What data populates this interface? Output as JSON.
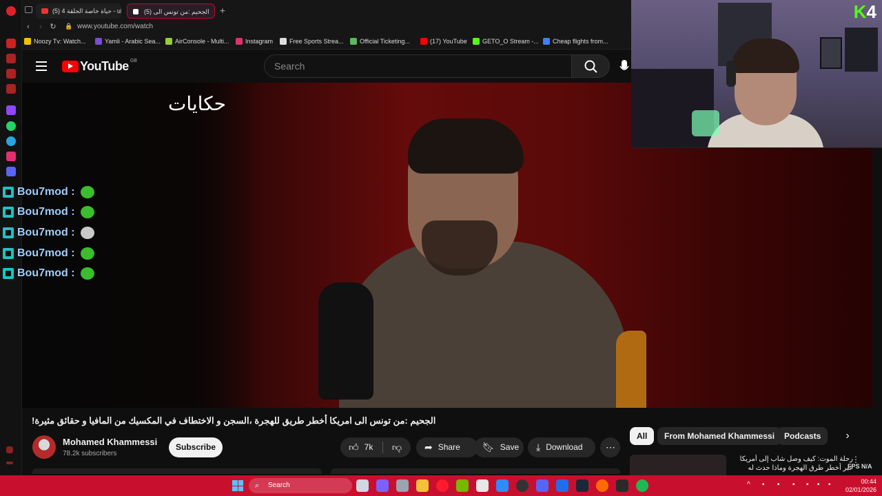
{
  "browser": {
    "tabs": [
      {
        "label": "(5) حياة خاصة الحلقة 4 - ube"
      },
      {
        "label": "(5) الجحيم :من تونس الى"
      }
    ],
    "new_tab": "+",
    "url": "www.youtube.com/watch",
    "bookmarks": [
      {
        "label": "Noozy Tv: Watch...",
        "color": "#f2c200"
      },
      {
        "label": "Yamli - Arabic Sea...",
        "color": "#7a4cd9"
      },
      {
        "label": "AirConsole - Multi...",
        "color": "#9acd32"
      },
      {
        "label": "Instagram",
        "color": "#e1306c"
      },
      {
        "label": "Free Sports Strea...",
        "color": "#dddddd"
      },
      {
        "label": "Official Ticketing...",
        "color": "#5cb85c"
      },
      {
        "label": "(17) YouTube",
        "color": "#ff0000"
      },
      {
        "label": "GETO_O Stream -...",
        "color": "#53fc18"
      },
      {
        "label": "Cheap flights from...",
        "color": "#3b82f6"
      }
    ]
  },
  "header": {
    "logo_text": "YouTube",
    "region": "GB",
    "search_placeholder": "Search"
  },
  "video": {
    "overlay_text": "حكايات"
  },
  "chat": {
    "messages": [
      {
        "user": "Bou7mod :",
        "emote_color": "#3bbd2e"
      },
      {
        "user": "Bou7mod :",
        "emote_color": "#3bbd2e"
      },
      {
        "user": "Bou7mod :",
        "emote_color": "#c9c9c9"
      },
      {
        "user": "Bou7mod :",
        "emote_color": "#3bbd2e"
      },
      {
        "user": "Bou7mod :",
        "emote_color": "#3bbd2e"
      }
    ]
  },
  "webcam": {
    "logo_k": "K",
    "logo_num": "4"
  },
  "details": {
    "title": "الجحيم :من تونس الى امريكا أخطر طريق للهجرة ،السجن و الاختطاف في المكسيك من المافيا و حقائق مثيرة!",
    "channel": "Mohamed Khammessi",
    "subscribers": "78.2k subscribers",
    "subscribe": "Subscribe",
    "likes": "7k",
    "share": "Share",
    "save": "Save",
    "download": "Download",
    "more": "⋯"
  },
  "chips": {
    "all": "All",
    "from": "From Mohamed Khammessi",
    "podcasts": "Podcasts",
    "next": "›"
  },
  "recommendation": {
    "title": "رحلة الموت: كيف وصل شاب إلى أمريكا عبر أخطر طرق الهجرة وماذا حدث له"
  },
  "overlay": {
    "fps": "FPS N/A"
  },
  "taskbar": {
    "search": "Search",
    "time": "00:44",
    "date": "02/01/2026"
  },
  "colors": {
    "accent": "#ff0000",
    "taskbar": "#c8102e",
    "chat_name": "#9ed0ff",
    "kick_green": "#53fc18"
  }
}
